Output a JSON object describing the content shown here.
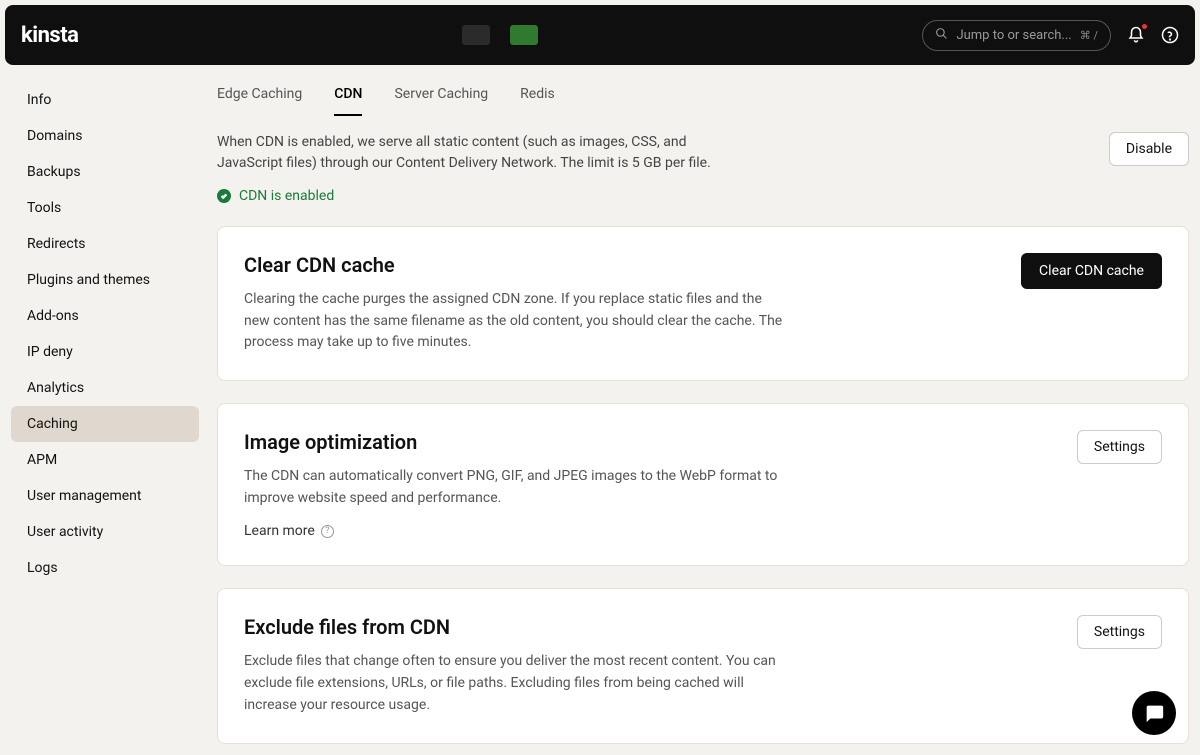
{
  "header": {
    "brand": "kinsta",
    "search_placeholder": "Jump to or search...",
    "search_hint": "⌘ /"
  },
  "sidebar": {
    "items": [
      {
        "label": "Info"
      },
      {
        "label": "Domains"
      },
      {
        "label": "Backups"
      },
      {
        "label": "Tools"
      },
      {
        "label": "Redirects"
      },
      {
        "label": "Plugins and themes"
      },
      {
        "label": "Add-ons"
      },
      {
        "label": "IP deny"
      },
      {
        "label": "Analytics"
      },
      {
        "label": "Caching"
      },
      {
        "label": "APM"
      },
      {
        "label": "User management"
      },
      {
        "label": "User activity"
      },
      {
        "label": "Logs"
      }
    ],
    "active_index": 9
  },
  "tabs": {
    "items": [
      "Edge Caching",
      "CDN",
      "Server Caching",
      "Redis"
    ],
    "active_index": 1
  },
  "intro": {
    "text": "When CDN is enabled, we serve all static content (such as images, CSS, and JavaScript files) through our Content Delivery Network. The limit is 5 GB per file.",
    "disable_label": "Disable",
    "status_text": "CDN is enabled"
  },
  "cards": {
    "clear": {
      "title": "Clear CDN cache",
      "body": "Clearing the cache purges the assigned CDN zone. If you replace static files and the new content has the same filename as the old content, you should clear the cache. The process may take up to five minutes.",
      "button": "Clear CDN cache"
    },
    "imgopt": {
      "title": "Image optimization",
      "body": "The CDN can automatically convert PNG, GIF, and JPEG images to the WebP format to improve website speed and performance.",
      "learn_more": "Learn more",
      "button": "Settings"
    },
    "exclude": {
      "title": "Exclude files from CDN",
      "body": "Exclude files that change often to ensure you deliver the most recent content. You can exclude file extensions, URLs, or file paths. Excluding files from being cached will increase your resource usage.",
      "button": "Settings"
    }
  }
}
